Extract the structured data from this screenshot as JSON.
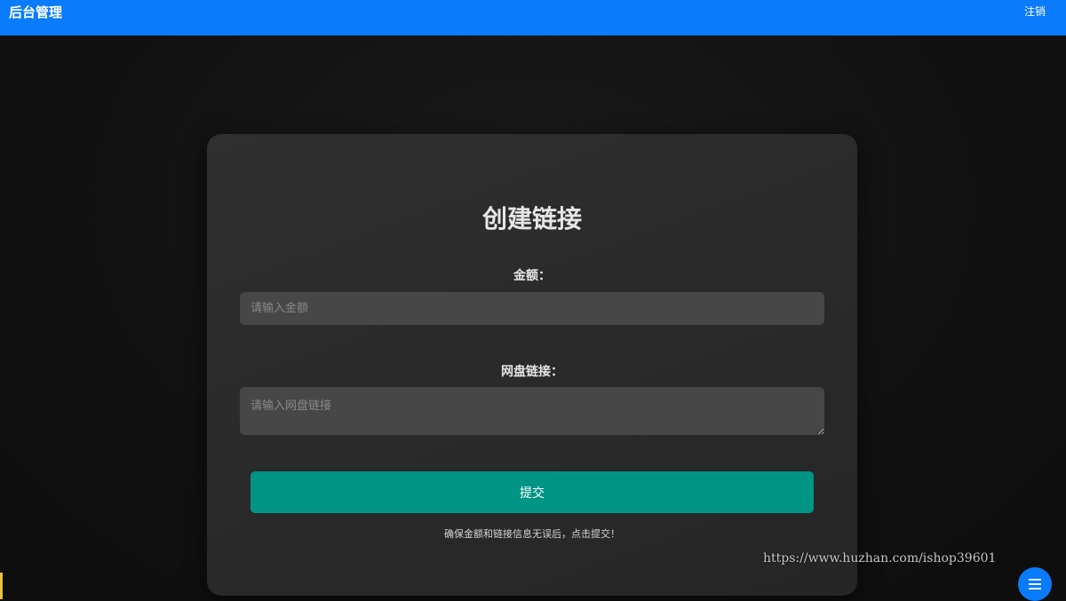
{
  "header": {
    "title": "后台管理",
    "logout_label": "注销"
  },
  "form": {
    "title": "创建链接",
    "amount_label": "金额：",
    "amount_placeholder": "请输入金额",
    "amount_value": "",
    "link_label": "网盘链接：",
    "link_placeholder": "请输入网盘链接",
    "link_value": "",
    "submit_label": "提交",
    "hint": "确保金额和链接信息无误后，点击提交！"
  },
  "watermark": "https://www.huzhan.com/ishop39601",
  "fab": {
    "icon": "menu-icon"
  },
  "colors": {
    "header_bg": "#0a7bfb",
    "submit_bg": "#009485",
    "card_bg": "#2b2b2b",
    "input_bg": "#474747"
  }
}
